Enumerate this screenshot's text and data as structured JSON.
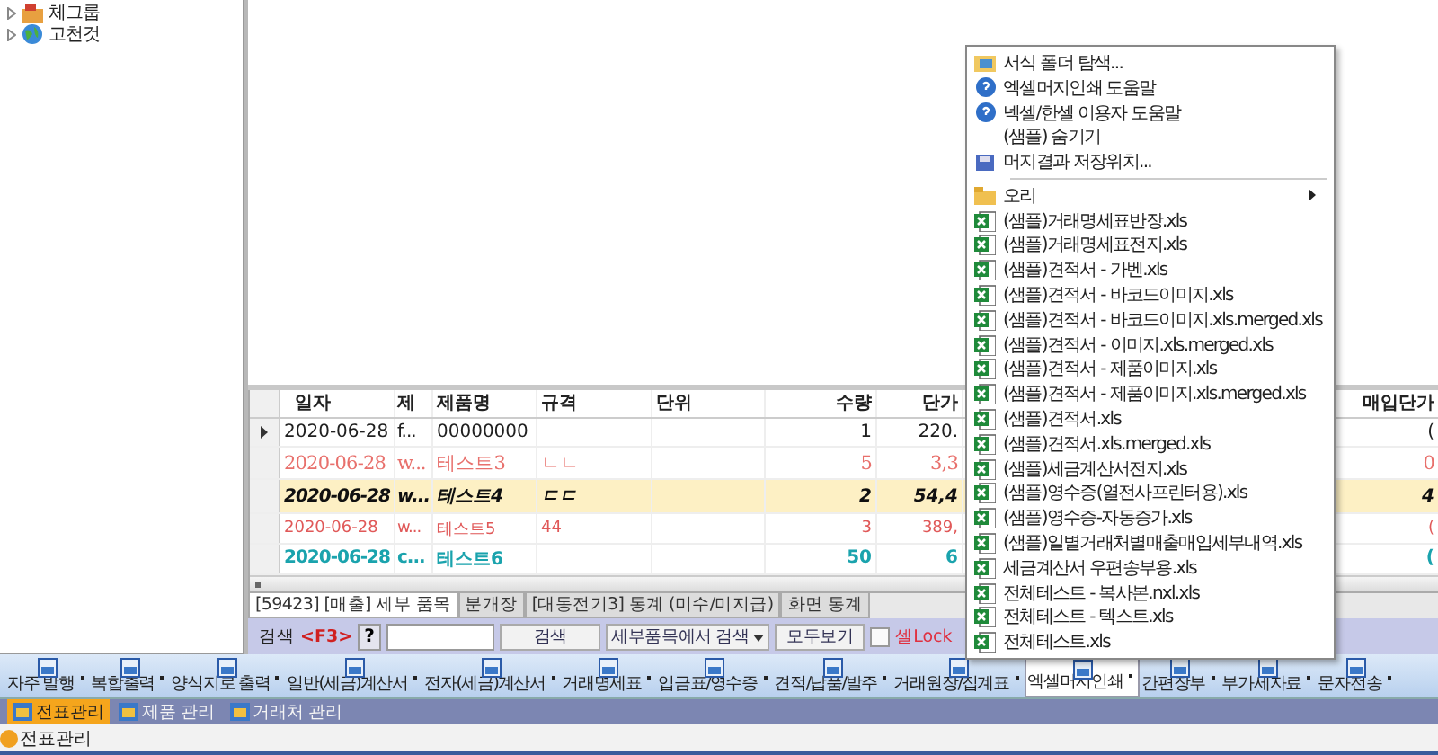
{
  "tree": {
    "items": [
      {
        "label": "체그룹",
        "kind": "group"
      },
      {
        "label": "고천것",
        "kind": "globe"
      }
    ]
  },
  "grid": {
    "columns": [
      "일자",
      "제",
      "제품명",
      "규격",
      "단위",
      "수량",
      "단가",
      "매입단가"
    ],
    "rows": [
      {
        "current": true,
        "kind": "normal",
        "color": "#202020",
        "date": "2020-06-28",
        "col_2": "f...",
        "name": "00000000",
        "qty": "1",
        "price": "220.",
        "purchase_price": "("
      },
      {
        "current": false,
        "kind": "large",
        "color": "#e8706c",
        "date": "2020-06-28",
        "col_2": "w...",
        "name": "테스트3",
        "spec": "ㄴㄴ",
        "qty": "5",
        "price": "3,3",
        "purchase_price": "0"
      },
      {
        "current": false,
        "kind": "highlight",
        "color": "#101010",
        "date": "2020-06-28",
        "col_2": "w...",
        "name": "테스트4",
        "spec": "ㄷㄷ",
        "qty": "2",
        "price": "54,4",
        "purchase_price": "4"
      },
      {
        "current": false,
        "kind": "small",
        "color": "#e05858",
        "date": "2020-06-28",
        "col_2": "w...",
        "name": "테스트5",
        "spec": "44",
        "qty": "3",
        "price": "389,",
        "purchase_price": "("
      },
      {
        "current": false,
        "kind": "bold",
        "color": "#1aa3ad",
        "date": "2020-06-28",
        "col_2": "c...",
        "name": "테스트6",
        "qty": "50",
        "price": "6",
        "purchase_price": "("
      }
    ]
  },
  "bottom_tabs": [
    {
      "label": "[59423] [매출] 세부 품목",
      "selected": true
    },
    {
      "label": "분개장",
      "selected": false
    },
    {
      "label": "[대동전기3] 통계 (미수/미지급)",
      "selected": false
    },
    {
      "label": "화면 통계",
      "selected": false
    }
  ],
  "search": {
    "label": "검색 ",
    "hotkey": "<F3>",
    "help": "?",
    "search_button": "검색",
    "scope": "세부품목에서 검색",
    "show_all": "모두보기",
    "lock": {
      "label": "셀Lock",
      "checked": false
    }
  },
  "toolbar": [
    {
      "label": "자주 발행",
      "selected": false
    },
    {
      "label": "복합출력",
      "selected": false
    },
    {
      "label": "양식지로 출력",
      "selected": false
    },
    {
      "label": "일반(세금)계산서",
      "selected": false
    },
    {
      "label": "전자(세금)계산서",
      "selected": false
    },
    {
      "label": "거래명세표",
      "selected": false
    },
    {
      "label": "입금표/영수증",
      "selected": false
    },
    {
      "label": "견적/납품/발주",
      "selected": false
    },
    {
      "label": "거래원장/집계표",
      "selected": false
    },
    {
      "label": "엑셀머지인쇄",
      "selected": true
    },
    {
      "label": "간편장부",
      "selected": false
    },
    {
      "label": "부가세자료",
      "selected": false
    },
    {
      "label": "문자전송",
      "selected": false
    }
  ],
  "module_tabs": [
    {
      "label": "전표관리",
      "selected": true
    },
    {
      "label": "제품 관리",
      "selected": false
    },
    {
      "label": "거래처 관리",
      "selected": false
    }
  ],
  "status_bar": {
    "label": "전표관리"
  },
  "menu": {
    "items": [
      {
        "label": "서식 폴더 탐색...",
        "kind": "folder-search"
      },
      {
        "label": "엑셀머지인쇄 도움말",
        "kind": "help"
      },
      {
        "label": "넥셀/한셀 이용자 도움말",
        "kind": "help"
      },
      {
        "label": "(샘플) 숨기기",
        "kind": "plain"
      },
      {
        "label": "머지결과 저장위치...",
        "kind": "save"
      },
      {
        "kind": "separator"
      },
      {
        "label": "오리",
        "kind": "submenu"
      },
      {
        "label": "(샘플)거래명세표반장.xls",
        "kind": "excel"
      },
      {
        "label": "(샘플)거래명세표전지.xls",
        "kind": "excel"
      },
      {
        "label": "(샘플)견적서 - 가벤.xls",
        "kind": "excel"
      },
      {
        "label": "(샘플)견적서 - 바코드이미지.xls",
        "kind": "excel"
      },
      {
        "label": "(샘플)견적서 - 바코드이미지.xls.merged.xls",
        "kind": "excel"
      },
      {
        "label": "(샘플)견적서 - 이미지.xls.merged.xls",
        "kind": "excel"
      },
      {
        "label": "(샘플)견적서 - 제품이미지.xls",
        "kind": "excel"
      },
      {
        "label": "(샘플)견적서 - 제품이미지.xls.merged.xls",
        "kind": "excel"
      },
      {
        "label": "(샘플)견적서.xls",
        "kind": "excel"
      },
      {
        "label": "(샘플)견적서.xls.merged.xls",
        "kind": "excel"
      },
      {
        "label": "(샘플)세금계산서전지.xls",
        "kind": "excel"
      },
      {
        "label": "(샘플)영수증(열전사프린터용).xls",
        "kind": "excel"
      },
      {
        "label": "(샘플)영수증-자동증가.xls",
        "kind": "excel"
      },
      {
        "label": "(샘플)일별거래처별매출매입세부내역.xls",
        "kind": "excel"
      },
      {
        "label": "세금계산서 우편송부용.xls",
        "kind": "excel"
      },
      {
        "label": "전체테스트 - 복사본.nxl.xls",
        "kind": "excel"
      },
      {
        "label": "전체테스트 - 텍스트.xls",
        "kind": "excel"
      },
      {
        "label": "전체테스트.xls",
        "kind": "excel"
      }
    ]
  }
}
